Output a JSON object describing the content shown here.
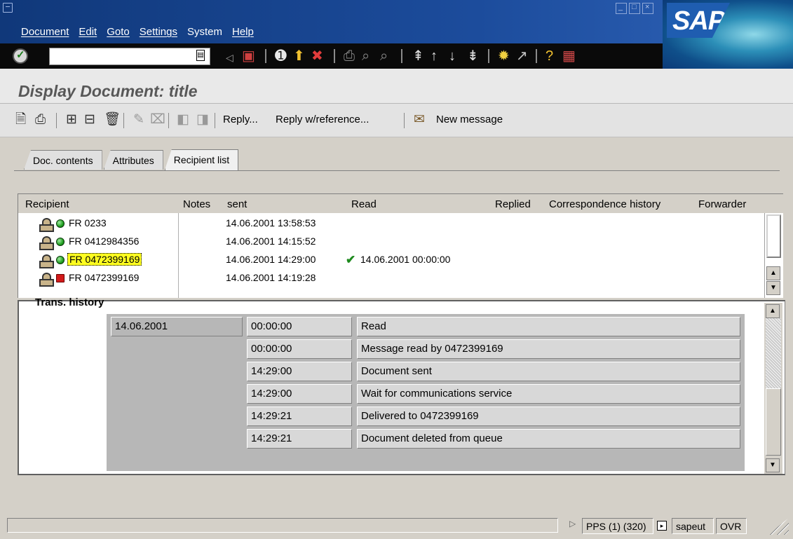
{
  "menubar": {
    "items": [
      "Document",
      "Edit",
      "Goto",
      "Settings",
      "System",
      "Help"
    ]
  },
  "window": {
    "logo": "SAP"
  },
  "screen_title": "Display Document: title",
  "app_toolbar": {
    "reply": "Reply...",
    "reply_ref": "Reply w/reference...",
    "new_message": "New message"
  },
  "tabs": [
    {
      "label": "Doc. contents",
      "active": false
    },
    {
      "label": "Attributes",
      "active": false
    },
    {
      "label": "Recipient list",
      "active": true
    }
  ],
  "recipient_list": {
    "columns": [
      "Recipient",
      "Notes",
      "sent",
      "Read",
      "Replied",
      "Correspondence history",
      "Forwarder"
    ],
    "rows": [
      {
        "status": "green",
        "recipient": "FR 0233",
        "sent": "14.06.2001 13:58:53",
        "read": ""
      },
      {
        "status": "green",
        "recipient": "FR 0412984356",
        "sent": "14.06.2001 14:15:52",
        "read": ""
      },
      {
        "status": "green",
        "recipient": "FR 0472399169",
        "sent": "14.06.2001 14:29:00",
        "read": "14.06.2001 00:00:00",
        "selected": true
      },
      {
        "status": "red",
        "recipient": "FR 0472399169",
        "sent": "14.06.2001 14:19:28",
        "read": ""
      }
    ]
  },
  "trans_history": {
    "title": "Trans. history",
    "date": "14.06.2001",
    "entries": [
      {
        "time": "00:00:00",
        "text": "Read"
      },
      {
        "time": "00:00:00",
        "text": "Message read by 0472399169"
      },
      {
        "time": "14:29:00",
        "text": "Document sent"
      },
      {
        "time": "14:29:00",
        "text": "Wait for communications service"
      },
      {
        "time": "14:29:21",
        "text": "Delivered to 0472399169"
      },
      {
        "time": "14:29:21",
        "text": "Document deleted from queue"
      }
    ]
  },
  "statusbar": {
    "system": "PPS (1) (320)",
    "server": "sapeut",
    "mode": "OVR"
  },
  "colors": {
    "title_bar": "#1c4c9c",
    "toolbar": "#0a0a0a",
    "selected_highlight": "#ffff20",
    "status_ok": "#1f9f1f",
    "status_error": "#d21a1a"
  }
}
